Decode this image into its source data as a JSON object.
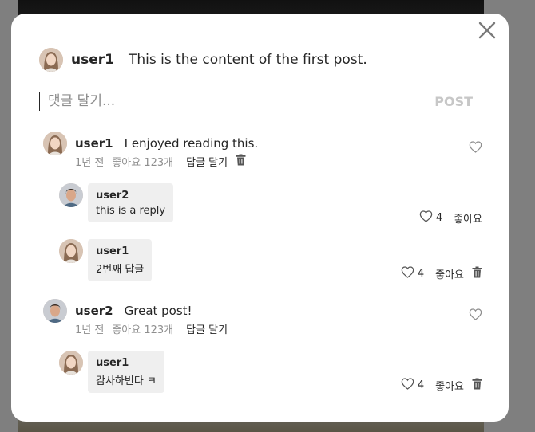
{
  "post": {
    "username": "user1",
    "text": "This is the content of the first post."
  },
  "comment_input": {
    "placeholder": "댓글 달기...",
    "post_label": "POST"
  },
  "comments": [
    {
      "username": "user1",
      "text": "I enjoyed reading this.",
      "time": "1년 전",
      "likes": "좋아요 123개",
      "reply_label": "답글 달기",
      "replies": [
        {
          "username": "user2",
          "text": "this is a reply",
          "like_count": "4",
          "like_label": "좋아요"
        },
        {
          "username": "user1",
          "text": "2번째 답글",
          "like_count": "4",
          "like_label": "좋아요"
        }
      ]
    },
    {
      "username": "user2",
      "text": "Great post!",
      "time": "1년 전",
      "likes": "좋아요 123개",
      "reply_label": "답글 달기",
      "replies": [
        {
          "username": "user1",
          "text": "감사하빈다 ㅋ",
          "like_count": "4",
          "like_label": "좋아요"
        }
      ]
    }
  ],
  "icons": {
    "close": "close-icon",
    "heart": "heart-icon",
    "trash": "trash-icon",
    "avatar_female": "avatar-female",
    "avatar_male": "avatar-male"
  }
}
